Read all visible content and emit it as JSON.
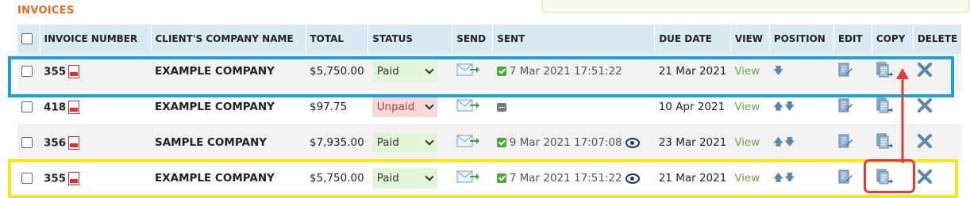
{
  "section_title": "INVOICES",
  "columns": {
    "invoice_number": "INVOICE NUMBER",
    "client": "CLIENT'S COMPANY NAME",
    "total": "TOTAL",
    "status": "STATUS",
    "send": "SEND",
    "sent": "SENT",
    "due_date": "DUE DATE",
    "view": "VIEW",
    "position": "POSITION",
    "edit": "EDIT",
    "copy": "COPY",
    "delete": "DELETE"
  },
  "rows": [
    {
      "number": "355",
      "client": "EXAMPLE COMPANY",
      "total": "$5,750.00",
      "status": "Paid",
      "sent_date": "7 Mar 2021 17:51:22",
      "due_date": "21 Mar 2021",
      "view": "View"
    },
    {
      "number": "418",
      "client": "EXAMPLE COMPANY",
      "total": "$97.75",
      "status": "Unpaid",
      "sent_date": "",
      "due_date": "10 Apr 2021",
      "view": "View"
    },
    {
      "number": "356",
      "client": "SAMPLE COMPANY",
      "total": "$7,935.00",
      "status": "Paid",
      "sent_date": "9 Mar 2021 17:07:08",
      "due_date": "23 Mar 2021",
      "view": "View"
    },
    {
      "number": "355",
      "client": "EXAMPLE COMPANY",
      "total": "$5,750.00",
      "status": "Paid",
      "sent_date": "7 Mar 2021 17:51:22",
      "due_date": "21 Mar 2021",
      "view": "View"
    }
  ],
  "colors": {
    "title": "#e86a1c",
    "header_bg": "#daeaf5",
    "paid_bg": "#e3f5d9",
    "unpaid_bg": "#f7d9d9",
    "highlight_blue": "#1ea0dc",
    "highlight_yellow": "#f2ea17",
    "highlight_red": "#e23a3a"
  }
}
